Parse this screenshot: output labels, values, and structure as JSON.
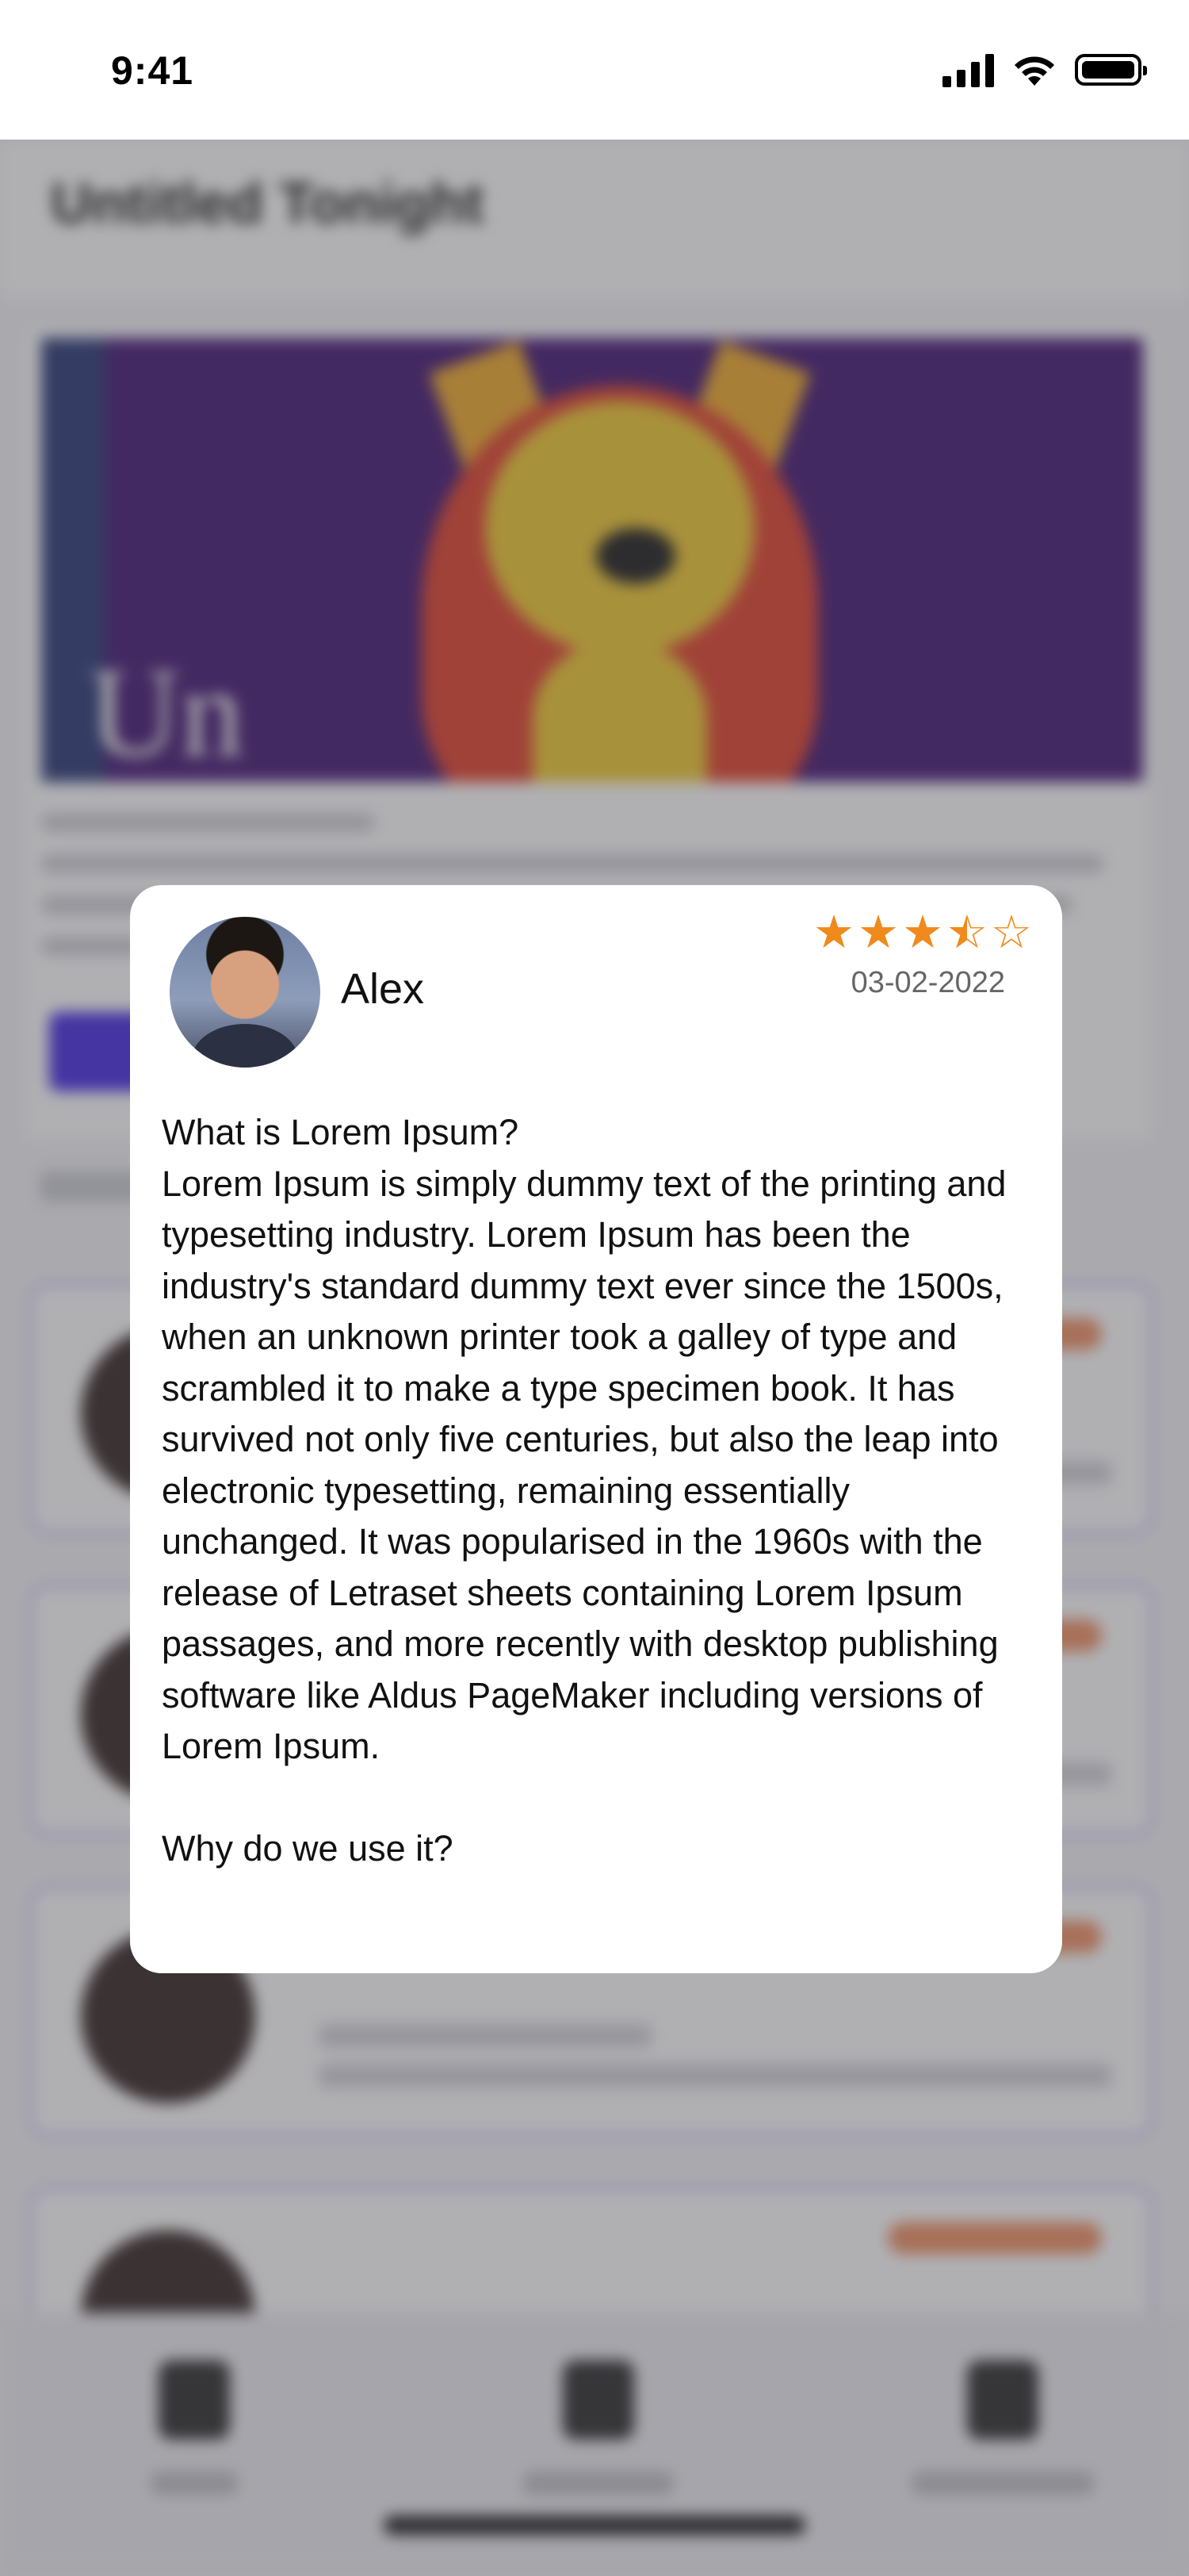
{
  "status_bar": {
    "time": "9:41",
    "icons": [
      "signal-icon",
      "wifi-icon",
      "battery-icon"
    ]
  },
  "background_page": {
    "title": "Untitled Tonight"
  },
  "review_modal": {
    "reviewer_name": "Alex",
    "rating": 3.5,
    "rating_max": 5,
    "date": "03-02-2022",
    "body": "What is Lorem Ipsum?\nLorem Ipsum is simply dummy text of the printing and typesetting industry. Lorem Ipsum has been the industry's standard dummy text ever since the 1500s, when an unknown printer took a galley of type and scrambled it to make a type specimen book. It has survived not only five centuries, but also the leap into electronic typesetting, remaining essentially unchanged. It was popularised in the 1960s with the release of Letraset sheets containing Lorem Ipsum passages, and more recently with desktop publishing software like Aldus PageMaker including versions of Lorem Ipsum.\n\nWhy do we use it?"
  },
  "colors": {
    "star": "#f08a1c",
    "overlay": "#50505673",
    "modal_bg": "#ffffff"
  }
}
